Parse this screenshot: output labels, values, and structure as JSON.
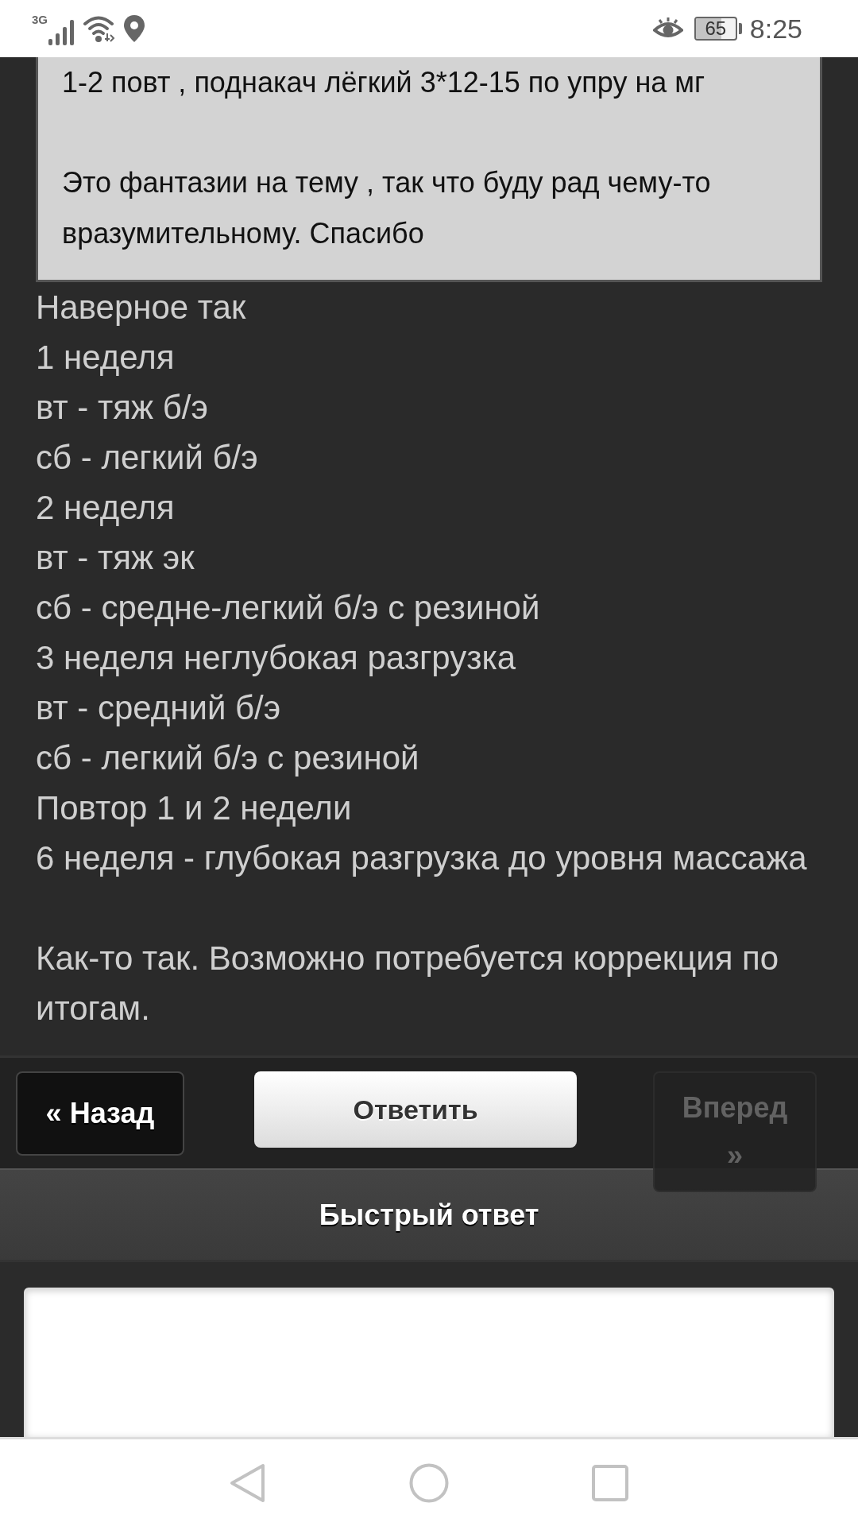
{
  "status_bar": {
    "network": "3G",
    "battery": "65",
    "time": "8:25"
  },
  "quote": {
    "paragraphs": [
      "1-2 повт , поднакач лёгкий 3*12-15 по упру на мг",
      "Это фантазии на тему , так что буду рад чему-то вразумительному. Спасибо"
    ]
  },
  "post": {
    "paragraphs": [
      [
        "Наверное так",
        "1 неделя",
        "вт - тяж б/э",
        "сб - легкий б/э",
        "2 неделя",
        "вт - тяж эк",
        "сб - средне-легкий б/э с резиной",
        "3 неделя неглубокая разгрузка",
        "вт - средний б/э",
        "сб - легкий б/э с резиной",
        "Повтор 1 и 2 недели",
        "6 неделя - глубокая разгрузка до уровня массажа"
      ],
      [
        "Как-то так. Возможно потребуется коррекция по итогам."
      ]
    ]
  },
  "pager": [
    {
      "kind": "back",
      "label": "« Назад",
      "disabled": false
    },
    {
      "kind": "reply",
      "label": "Ответить",
      "disabled": false
    },
    {
      "kind": "forward",
      "label": "Вперед »",
      "disabled": true
    }
  ],
  "quick_reply": {
    "title": "Быстрый ответ"
  }
}
